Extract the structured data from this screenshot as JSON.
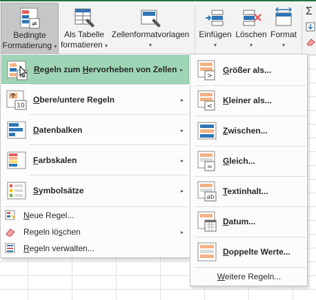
{
  "ribbon": {
    "conditional": {
      "line1": "Bedingte",
      "line2": "Formatierung"
    },
    "as_table": {
      "line1": "Als Tabelle",
      "line2": "formatieren"
    },
    "cell_styles": {
      "line1": "Zellenformatvorlagen"
    },
    "insert": {
      "line1": "Einfügen"
    },
    "delete": {
      "line1": "Löschen"
    },
    "format": {
      "line1": "Format"
    },
    "sigma": "Σ",
    "caret": "▾"
  },
  "menu": {
    "items": [
      {
        "pre": "",
        "key": "R",
        "post": "egeln zum ",
        "key2": "H",
        "post2": "ervorheben von Zellen",
        "icon": "highlight-cells-rules-icon"
      },
      {
        "pre": "",
        "key": "O",
        "post": "bere/untere Regeln",
        "icon": "top-bottom-rules-icon",
        "badge": "10"
      },
      {
        "pre": "",
        "key": "D",
        "post": "atenbalken",
        "icon": "data-bars-icon"
      },
      {
        "pre": "",
        "key": "F",
        "post": "arbskalen",
        "icon": "color-scales-icon"
      },
      {
        "pre": "",
        "key": "S",
        "post": "ymbolsätze",
        "icon": "icon-sets-icon"
      }
    ],
    "small_items": [
      {
        "pre": "",
        "key": "N",
        "post": "eue Regel...",
        "icon": "new-rule-icon"
      },
      {
        "pre": "Regeln lö",
        "key": "s",
        "post": "chen",
        "icon": "clear-rules-icon"
      },
      {
        "pre": "",
        "key": "R",
        "post": "egeln verwalten...",
        "icon": "manage-rules-icon"
      }
    ],
    "arrow": "▸"
  },
  "submenu": {
    "items": [
      {
        "key": "G",
        "post": "rößer als...",
        "icon": "greater-than-icon",
        "symbol": ">"
      },
      {
        "key": "K",
        "post": "leiner als...",
        "icon": "less-than-icon",
        "symbol": "<"
      },
      {
        "key": "Z",
        "post": "wischen...",
        "icon": "between-icon",
        "symbol": ""
      },
      {
        "key": "G",
        "post": "leich...",
        "icon": "equal-to-icon",
        "symbol": "="
      },
      {
        "key": "T",
        "post": "extinhalt...",
        "icon": "text-contains-icon",
        "symbol": "ab"
      },
      {
        "key": "D",
        "post": "atum...",
        "icon": "date-occurring-icon",
        "symbol": ""
      },
      {
        "key": "D",
        "post": "oppelte Werte...",
        "icon": "duplicate-values-icon",
        "symbol": ""
      }
    ],
    "more": {
      "key": "W",
      "post": "eitere Regeln..."
    }
  },
  "colors": {
    "accent": "#217346",
    "highlight": "#9fd5b7",
    "icon_blue": "#2e75b6",
    "icon_orange": "#f4b183",
    "icon_red": "#e15b5b"
  }
}
